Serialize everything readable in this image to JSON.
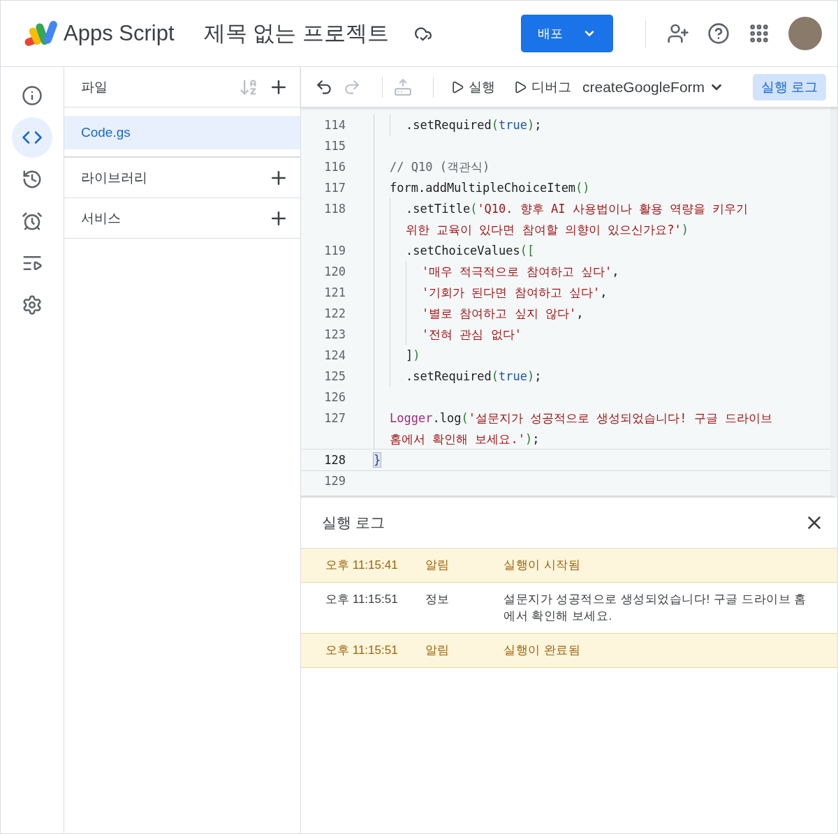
{
  "header": {
    "product": "Apps Script",
    "project_title": "제목 없는 프로젝트",
    "deploy_button": "배포"
  },
  "rail": [
    {
      "kind": "info",
      "selected": false
    },
    {
      "kind": "code",
      "selected": true
    },
    {
      "kind": "history",
      "selected": false
    },
    {
      "kind": "triggers",
      "selected": false
    },
    {
      "kind": "executions",
      "selected": false
    },
    {
      "kind": "settings",
      "selected": false
    }
  ],
  "files": {
    "title": "파일",
    "items": [
      {
        "label": "Code.gs",
        "selected": true
      }
    ],
    "sections": [
      {
        "label": "라이브러리"
      },
      {
        "label": "서비스"
      }
    ]
  },
  "toolbar": {
    "buttons": [
      {
        "kind": "undo",
        "disabled": false
      },
      {
        "kind": "redo",
        "disabled": true
      },
      {
        "kind": "save",
        "disabled": true
      }
    ],
    "run": "실행",
    "debug": "디버그",
    "function_select": "createGoogleForm",
    "log_button": {
      "label": "실행 로그",
      "selected": true
    }
  },
  "code": {
    "lines": [
      {
        "children": [
          {
            "children": [
              {
                "number": "114",
                "current": false,
                "tokens": [
                  {
                    "kind": "plain",
                    "text": ".setRequired"
                  },
                  {
                    "kind": "bracket",
                    "text": "("
                  },
                  {
                    "kind": "keyword",
                    "text": "true"
                  },
                  {
                    "kind": "bracket",
                    "text": ")"
                  },
                  {
                    "kind": "plain",
                    "text": ";"
                  }
                ]
              }
            ]
          },
          {
            "number": "115",
            "current": false
          },
          {
            "number": "116",
            "current": false,
            "tokens": [
              {
                "kind": "comment",
                "text": "// Q10 (객관식)"
              }
            ]
          },
          {
            "number": "117",
            "current": false,
            "tokens": [
              {
                "kind": "plain",
                "text": "form.addMultipleChoiceItem"
              },
              {
                "kind": "bracket",
                "text": "()"
              }
            ]
          },
          {
            "children": [
              {
                "number": "118",
                "current": false,
                "tokens": [
                  {
                    "kind": "plain",
                    "text": ".setTitle"
                  },
                  {
                    "kind": "bracket",
                    "text": "("
                  },
                  {
                    "kind": "string",
                    "text": "'Q10. 향후 AI 사용법이나 활용 역량을 키우기 위한 교육이 있다면 참여할 의향이 있으신가요?'"
                  },
                  {
                    "kind": "bracket",
                    "text": ")"
                  }
                ]
              },
              {
                "number": "119",
                "current": false,
                "tokens": [
                  {
                    "kind": "plain",
                    "text": ".setChoiceValues"
                  },
                  {
                    "kind": "bracket",
                    "text": "(["
                  }
                ]
              },
              {
                "children": [
                  {
                    "number": "120",
                    "current": false,
                    "tokens": [
                      {
                        "kind": "string",
                        "text": "'매우 적극적으로 참여하고 싶다'"
                      },
                      {
                        "kind": "plain",
                        "text": ","
                      }
                    ]
                  },
                  {
                    "number": "121",
                    "current": false,
                    "tokens": [
                      {
                        "kind": "string",
                        "text": "'기회가 된다면 참여하고 싶다'"
                      },
                      {
                        "kind": "plain",
                        "text": ","
                      }
                    ]
                  },
                  {
                    "number": "122",
                    "current": false,
                    "tokens": [
                      {
                        "kind": "string",
                        "text": "'별로 참여하고 싶지 않다'"
                      },
                      {
                        "kind": "plain",
                        "text": ","
                      }
                    ]
                  },
                  {
                    "number": "123",
                    "current": false,
                    "tokens": [
                      {
                        "kind": "string",
                        "text": "'전혀 관심 없다'"
                      }
                    ]
                  }
                ]
              },
              {
                "number": "124",
                "current": false,
                "tokens": [
                  {
                    "kind": "plain",
                    "text": "]"
                  },
                  {
                    "kind": "bracket",
                    "text": ")"
                  }
                ]
              },
              {
                "number": "125",
                "current": false,
                "tokens": [
                  {
                    "kind": "plain",
                    "text": ".setRequired"
                  },
                  {
                    "kind": "bracket",
                    "text": "("
                  },
                  {
                    "kind": "keyword",
                    "text": "true"
                  },
                  {
                    "kind": "bracket",
                    "text": ")"
                  },
                  {
                    "kind": "plain",
                    "text": ";"
                  }
                ]
              }
            ]
          },
          {
            "number": "126",
            "current": false
          },
          {
            "number": "127",
            "current": false,
            "tokens": [
              {
                "kind": "object",
                "text": "Logger"
              },
              {
                "kind": "plain",
                "text": ".log"
              },
              {
                "kind": "bracket",
                "text": "("
              },
              {
                "kind": "string",
                "text": "'설문지가 성공적으로 생성되었습니다! 구글 드라이브 홈에서 확인해 보세요.'"
              },
              {
                "kind": "bracket",
                "text": ")"
              },
              {
                "kind": "plain",
                "text": ";"
              }
            ]
          }
        ]
      },
      {
        "number": "128",
        "current": true,
        "tokens": [
          {
            "kind": "matched",
            "text": "}"
          }
        ]
      },
      {
        "number": "129",
        "current": false
      }
    ]
  },
  "log": {
    "title": "실행 로그",
    "entries": [
      {
        "kind": "notice",
        "time": "오후 11:15:41",
        "level_label": "알림",
        "message": "실행이 시작됨"
      },
      {
        "kind": "info",
        "time": "오후 11:15:51",
        "level_label": "정보",
        "message": "설문지가 성공적으로 생성되었습니다! 구글 드라이브 홈에서 확인해 보세요."
      },
      {
        "kind": "notice",
        "time": "오후 11:15:51",
        "level_label": "알림",
        "message": "실행이 완료됨"
      }
    ]
  }
}
